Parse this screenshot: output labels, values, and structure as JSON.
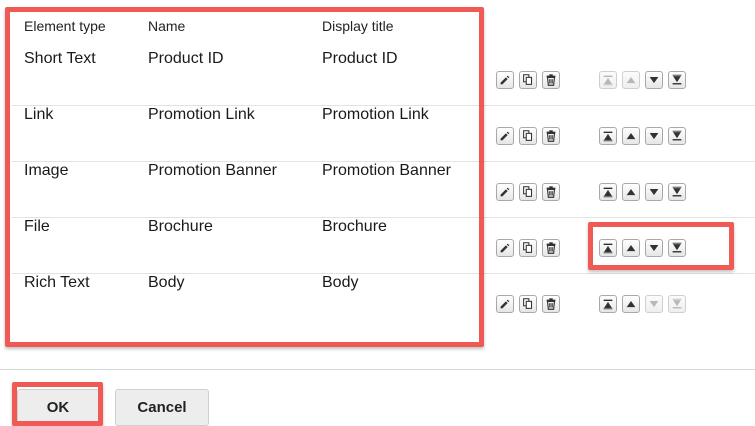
{
  "table": {
    "headers": {
      "element_type": "Element type",
      "name": "Name",
      "display_title": "Display title"
    },
    "rows": [
      {
        "element_type": "Short Text",
        "name": "Product ID",
        "display_title": "Product ID",
        "move_top_enabled": false,
        "move_up_enabled": false,
        "move_down_enabled": true,
        "move_bottom_enabled": true
      },
      {
        "element_type": "Link",
        "name": "Promotion Link",
        "display_title": "Promotion Link",
        "move_top_enabled": true,
        "move_up_enabled": true,
        "move_down_enabled": true,
        "move_bottom_enabled": true
      },
      {
        "element_type": "Image",
        "name": "Promotion Banner",
        "display_title": "Promotion Banner",
        "move_top_enabled": true,
        "move_up_enabled": true,
        "move_down_enabled": true,
        "move_bottom_enabled": true
      },
      {
        "element_type": "File",
        "name": "Brochure",
        "display_title": "Brochure",
        "move_top_enabled": true,
        "move_up_enabled": true,
        "move_down_enabled": true,
        "move_bottom_enabled": true
      },
      {
        "element_type": "Rich Text",
        "name": "Body",
        "display_title": "Body",
        "move_top_enabled": true,
        "move_up_enabled": true,
        "move_down_enabled": false,
        "move_bottom_enabled": false
      }
    ],
    "row_actions": [
      "edit-icon",
      "copy-icon",
      "trash-icon",
      "move-to-top-icon",
      "move-up-icon",
      "move-down-icon",
      "move-to-bottom-icon"
    ]
  },
  "footer": {
    "ok_label": "OK",
    "cancel_label": "Cancel"
  },
  "colors": {
    "highlight": "#ef5a55",
    "icon_active": "#333333",
    "icon_disabled": "#b8b8b8"
  }
}
